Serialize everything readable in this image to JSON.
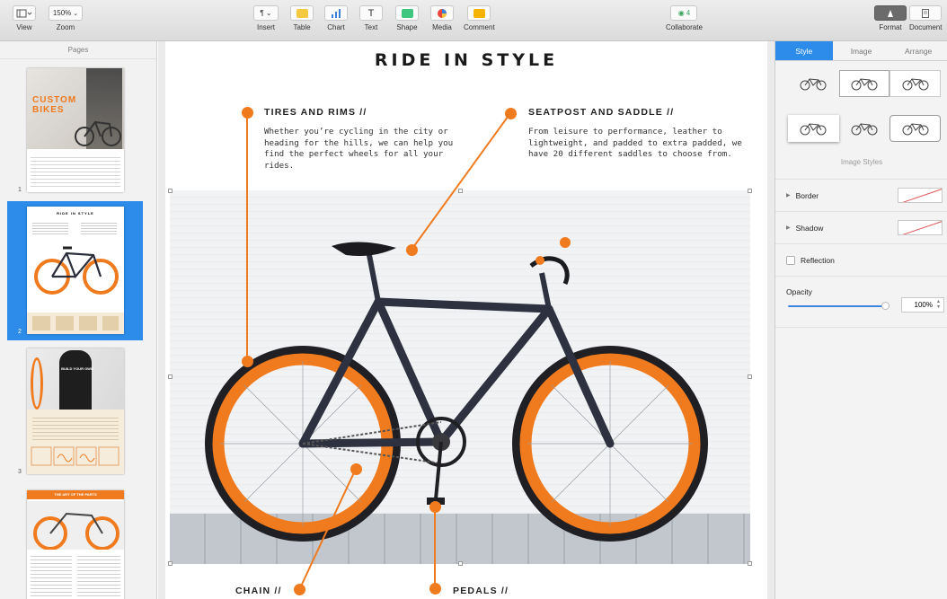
{
  "toolbar": {
    "view": {
      "label": "View"
    },
    "zoom": {
      "label": "Zoom",
      "value": "150%"
    },
    "insert": {
      "label": "Insert"
    },
    "table": {
      "label": "Table"
    },
    "chart": {
      "label": "Chart"
    },
    "text": {
      "label": "Text"
    },
    "shape": {
      "label": "Shape"
    },
    "media": {
      "label": "Media"
    },
    "comment": {
      "label": "Comment"
    },
    "collaborate": {
      "label": "Collaborate",
      "count": "4"
    },
    "format": {
      "label": "Format"
    },
    "document": {
      "label": "Document"
    }
  },
  "sidebar": {
    "header": "Pages",
    "pages": [
      {
        "number": "1",
        "thumb_title": "CUSTOM BIKES",
        "selected": false
      },
      {
        "number": "2",
        "thumb_title": "RIDE IN STYLE",
        "selected": true
      },
      {
        "number": "3",
        "thumb_title": "BUILD YOUR OWN",
        "selected": false
      },
      {
        "number": "",
        "thumb_title": "THE ART OF THE PARTS",
        "selected": false
      }
    ]
  },
  "document": {
    "title": "RIDE IN STYLE",
    "callouts": [
      {
        "heading": "TIRES AND RIMS //",
        "body": "Whether you’re cycling in the city or heading for the hills, we can help you find the perfect wheels for all your rides."
      },
      {
        "heading": "SEATPOST AND SADDLE //",
        "body": "From leisure to performance, leather to lightweight, and padded to extra padded, we have 20 different saddles to choose from."
      },
      {
        "heading": "CHAIN //",
        "body": ""
      },
      {
        "heading": "PEDALS //",
        "body": ""
      }
    ]
  },
  "inspector": {
    "tabs": [
      "Style",
      "Image",
      "Arrange"
    ],
    "active_tab": "Style",
    "image_styles_label": "Image Styles",
    "border_label": "Border",
    "shadow_label": "Shadow",
    "reflection_label": "Reflection",
    "reflection_checked": false,
    "opacity_label": "Opacity",
    "opacity_value": "100%"
  },
  "colors": {
    "accent": "#f07a1e",
    "selection": "#2d8bea"
  }
}
